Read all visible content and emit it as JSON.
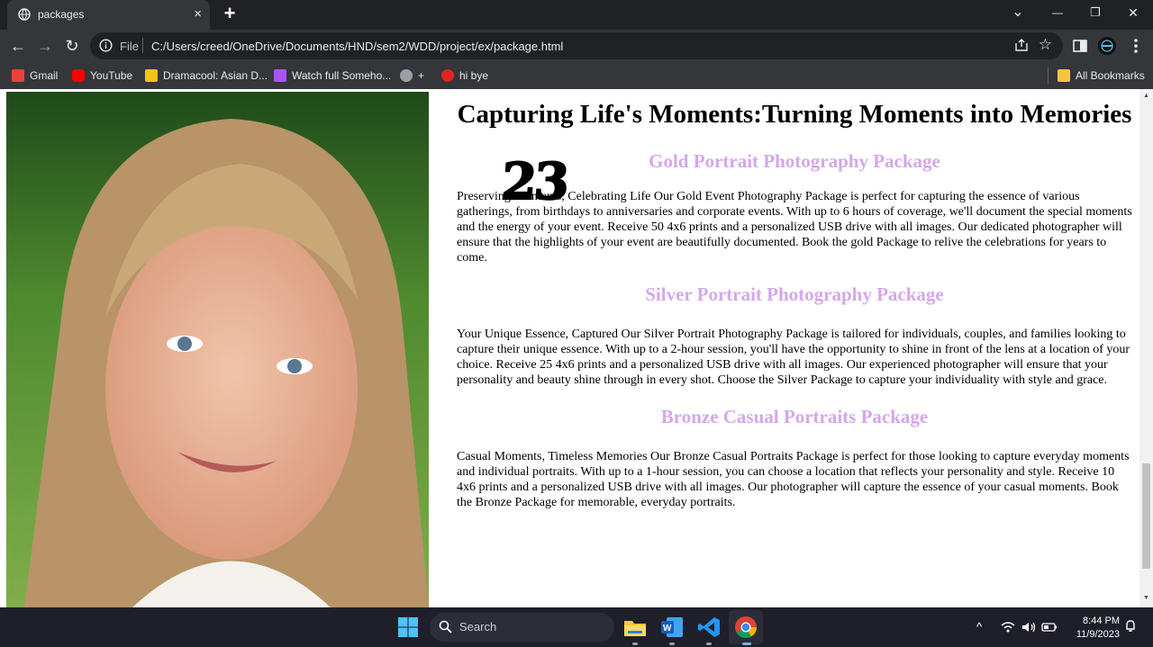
{
  "browser": {
    "tab": {
      "title": "packages",
      "close": "×"
    },
    "new_tab": "+",
    "window_controls": {
      "down": "⌄",
      "minimize": "—",
      "restore": "❐",
      "close": "✕"
    },
    "nav": {
      "back": "←",
      "forward": "→",
      "reload": "↻"
    },
    "omnibox": {
      "scheme": "File",
      "url": "C:/Users/creed/OneDrive/Documents/HND/sem2/WDD/project/ex/package.html",
      "star": "☆"
    },
    "bookmarks": [
      {
        "label": "Gmail",
        "icon": "gmail-icon",
        "color": "#ea4335"
      },
      {
        "label": "YouTube",
        "icon": "youtube-icon",
        "color": "#ff0000"
      },
      {
        "label": "Dramacool: Asian D...",
        "icon": "dramacool-icon",
        "color": "#f0c419"
      },
      {
        "label": "Watch full Someho...",
        "icon": "watch-icon",
        "color": "#a855f7"
      },
      {
        "label": "+",
        "icon": "globe-icon",
        "color": "#9aa0a6"
      },
      {
        "label": "hi bye",
        "icon": "hibye-icon",
        "color": "#e02424"
      }
    ],
    "all_bookmarks": "All Bookmarks"
  },
  "page": {
    "heading": "Capturing Life's Moments:Turning Moments into Memories",
    "counter": "23",
    "packages": [
      {
        "title": "Gold Portrait Photography Package",
        "text": "Preserving Moments, Celebrating Life Our Gold Event Photography Package is perfect for capturing the essence of various gatherings, from birthdays to anniversaries and corporate events. With up to 6 hours of coverage, we'll document the special moments and the energy of your event. Receive 50 4x6 prints and a personalized USB drive with all images. Our dedicated photographer will ensure that the highlights of your event are beautifully documented. Book the gold Package to relive the celebrations for years to come."
      },
      {
        "title": "Silver Portrait Photography Package",
        "text": "Your Unique Essence, Captured Our Silver Portrait Photography Package is tailored for individuals, couples, and families looking to capture their unique essence. With up to a 2-hour session, you'll have the opportunity to shine in front of the lens at a location of your choice. Receive 25 4x6 prints and a personalized USB drive with all images. Our experienced photographer will ensure that your personality and beauty shine through in every shot. Choose the Silver Package to capture your individuality with style and grace."
      },
      {
        "title": "Bronze Casual Portraits Package",
        "text": "Casual Moments, Timeless Memories Our Bronze Casual Portraits Package is perfect for those looking to capture everyday moments and individual portraits. With up to a 1-hour session, you can choose a location that reflects your personality and style. Receive 10 4x6 prints and a personalized USB drive with all images. Our photographer will capture the essence of your casual moments. Book the Bronze Package for memorable, everyday portraits."
      }
    ],
    "accent_color": "#d4a7ea"
  },
  "taskbar": {
    "search_label": "Search",
    "time": "8:44 PM",
    "date": "11/9/2023",
    "tray_chevron": "^"
  }
}
